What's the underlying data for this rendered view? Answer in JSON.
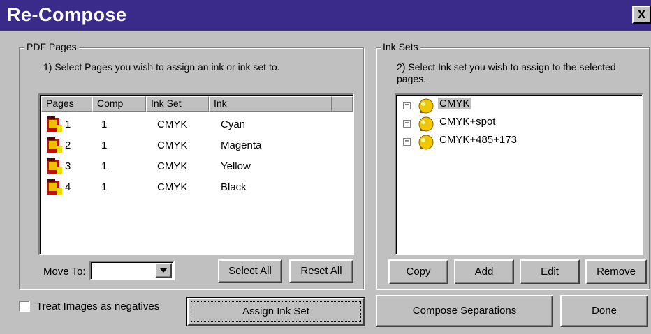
{
  "window": {
    "title": "Re-Compose",
    "close_label": "x"
  },
  "pdf_pages": {
    "group_label": "PDF Pages",
    "instruction": "1) Select Pages you wish to assign an ink or ink set to.",
    "columns": [
      "Pages",
      "Comp",
      "Ink Set",
      "Ink"
    ],
    "rows": [
      {
        "page": "1",
        "comp": "1",
        "ink_set": "CMYK",
        "ink": "Cyan"
      },
      {
        "page": "2",
        "comp": "1",
        "ink_set": "CMYK",
        "ink": "Magenta"
      },
      {
        "page": "3",
        "comp": "1",
        "ink_set": "CMYK",
        "ink": "Yellow"
      },
      {
        "page": "4",
        "comp": "1",
        "ink_set": "CMYK",
        "ink": "Black"
      }
    ],
    "move_to_label": "Move To:",
    "move_to_value": "",
    "select_all": "Select All",
    "reset_all": "Reset All"
  },
  "ink_sets": {
    "group_label": "Ink Sets",
    "instruction": "2) Select Ink set you wish to assign to the selected pages.",
    "items": [
      "CMYK",
      "CMYK+spot",
      "CMYK+485+173"
    ],
    "selected": "CMYK",
    "copy": "Copy",
    "add": "Add",
    "edit": "Edit",
    "remove": "Remove"
  },
  "footer": {
    "treat_negatives": "Treat Images as negatives",
    "treat_negatives_checked": false,
    "assign_ink_set": "Assign Ink Set",
    "compose_separations": "Compose Separations",
    "done": "Done"
  },
  "colors": {
    "title_bar": "#3a2a8a",
    "dialog_bg": "#c0c0c0",
    "selection": "#c0c0c0"
  }
}
